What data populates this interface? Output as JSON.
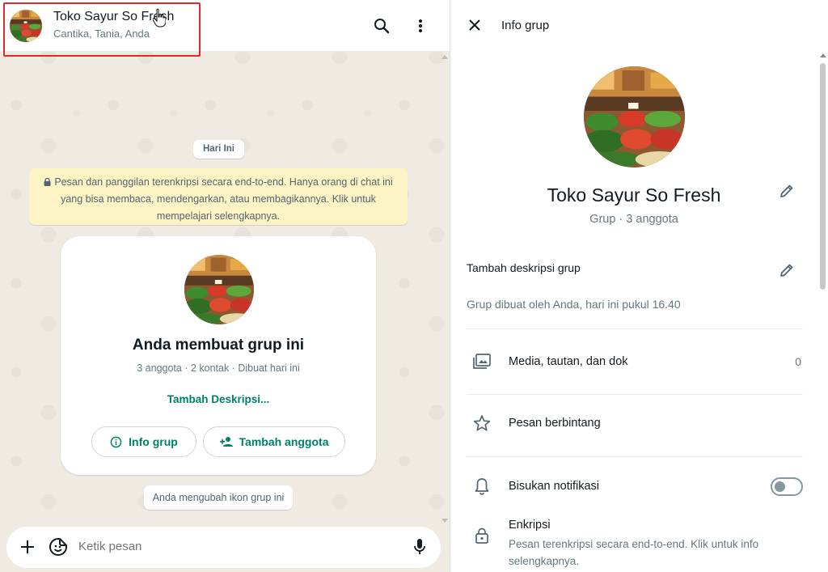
{
  "chat_header": {
    "title": "Toko Sayur So Fresh",
    "members": "Cantika, Tania, Anda"
  },
  "messages": {
    "date_label": "Hari Ini",
    "encryption_notice": "Pesan dan panggilan terenkripsi secara end-to-end. Hanya orang di chat ini yang bisa membaca, mendengarkan, atau membagikannya. Klik untuk mempelajari selengkapnya.",
    "group_card": {
      "title": "Anda membuat grup ini",
      "meta": "3 anggota · 2 kontak · Dibuat hari ini",
      "add_description": "Tambah Deskripsi...",
      "info_button": "Info grup",
      "add_member_button": "Tambah anggota"
    },
    "system_message": "Anda mengubah ikon grup ini"
  },
  "composer": {
    "placeholder": "Ketik pesan"
  },
  "info_panel": {
    "title": "Info grup",
    "group_name": "Toko Sayur So Fresh",
    "member_count": "Grup · 3 anggota",
    "add_description": "Tambah deskripsi grup",
    "created_text": "Grup dibuat oleh Anda, hari ini pukul 16.40",
    "media_label": "Media, tautan, dan dok",
    "media_count": "0",
    "starred_label": "Pesan berbintang",
    "mute_label": "Bisukan notifikasi",
    "encryption_title": "Enkripsi",
    "encryption_desc": "Pesan terenkripsi secara end-to-end. Klik untuk info selengkapnya."
  },
  "colors": {
    "accent_green": "#008069",
    "banner_yellow": "#fdf4c5",
    "chat_bg": "#efeae2",
    "highlight_red": "#e02a2a"
  }
}
